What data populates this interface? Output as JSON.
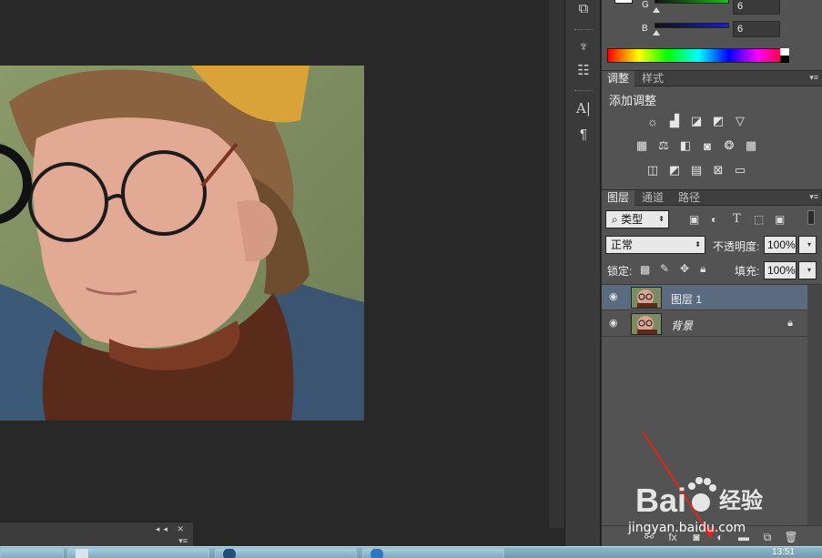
{
  "color_panel": {
    "channels": [
      {
        "label": "G",
        "value": "6",
        "color": "#1bbf1b"
      },
      {
        "label": "B",
        "value": "6",
        "color": "#1b1bd0"
      }
    ]
  },
  "adjustments_panel": {
    "tabs": [
      "调整",
      "样式"
    ],
    "heading": "添加调整",
    "icon_rows": [
      [
        "brightness-icon",
        "levels-icon",
        "curves-icon",
        "exposure-icon",
        "gradient-triangle-icon"
      ],
      [
        "vibrance-icon",
        "color-balance-icon",
        "black-white-icon",
        "photo-filter-icon",
        "channel-mixer-icon",
        "color-lookup-icon"
      ],
      [
        "invert-icon",
        "posterize-icon",
        "threshold-icon",
        "selective-color-icon",
        "gradient-map-icon"
      ]
    ]
  },
  "layers_panel": {
    "tabs": [
      "图层",
      "通道",
      "路径"
    ],
    "filter_kind": "类型",
    "blend_mode": "正常",
    "opacity_label": "不透明度:",
    "opacity_value": "100%",
    "lock_label": "锁定:",
    "fill_label": "填充:",
    "fill_value": "100%",
    "layers": [
      {
        "name": "图层 1",
        "selected": true,
        "locked": false
      },
      {
        "name": "背景",
        "selected": false,
        "locked": true
      }
    ]
  },
  "taskbar": {
    "clock": "13:51"
  },
  "watermark": {
    "brand": "Bai",
    "brand2": "经验",
    "url": "jingyan.baidu.com"
  },
  "colors": {
    "panel_bg": "#535353",
    "selected_layer": "#5a6b80",
    "canvas_bg": "#282828"
  }
}
